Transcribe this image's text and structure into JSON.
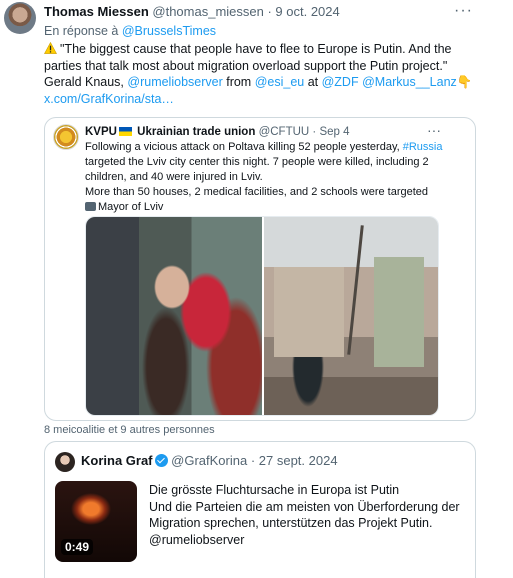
{
  "tweet": {
    "author_name": "Thomas Miessen",
    "author_handle": "@thomas_miessen",
    "separator": " · ",
    "date": "9 oct. 2024",
    "more": "···",
    "reply_prefix": "En réponse à ",
    "reply_to": "@BrusselsTimes",
    "text_1": "\"The biggest cause that people have to flee to Europe is Putin. And the parties that talk most about migration overload support the Putin project.\" Gerald Knaus, ",
    "mention_1": "@rumeliobserver",
    "text_2": " from ",
    "mention_2": "@esi_eu",
    "text_3": " at ",
    "mention_3": "@ZDF",
    "text_4": " ",
    "mention_4": "@Markus__Lanz",
    "emoji": "👇",
    "link": "x.com/GrafKorina/sta…",
    "warning_icon": "warning-icon"
  },
  "quote1": {
    "author_name": "KVPU",
    "author_suffix": " Ukrainian trade union",
    "author_handle": "@CFTUU",
    "separator": " · ",
    "date": "Sep 4",
    "more": "···",
    "text_1": "Following a vicious attack on Poltava killing 52 people yesterday, ",
    "hashtag": "#Russia",
    "text_2": " targeted the Lviv city center this night. 7  people were killed, including 2 children, and 40 were injured in Lviv.",
    "text_3": "More than 50 houses,  2 medical facilities, and 2 schools were targeted",
    "credit": "Mayor of Lviv",
    "flag_icon": "ukraine-flag-icon",
    "camera_icon": "camera-icon"
  },
  "likes_line": "8 meicoalitie et 9 autres personnes",
  "quote2": {
    "author_name": "Korina Graf",
    "author_handle": "@GrafKorina",
    "separator": " · ",
    "date": "27 sept. 2024",
    "video_duration": "0:49",
    "text": "Die grösste Fluchtursache in Europa ist Putin\nUnd die Parteien die am meisten von Überforderung der Migration sprechen, unterstützen das Projekt Putin.\n@rumeliobserver"
  },
  "colors": {
    "link": "#1d9bf0",
    "muted": "#536471",
    "border": "#cfd9de"
  }
}
